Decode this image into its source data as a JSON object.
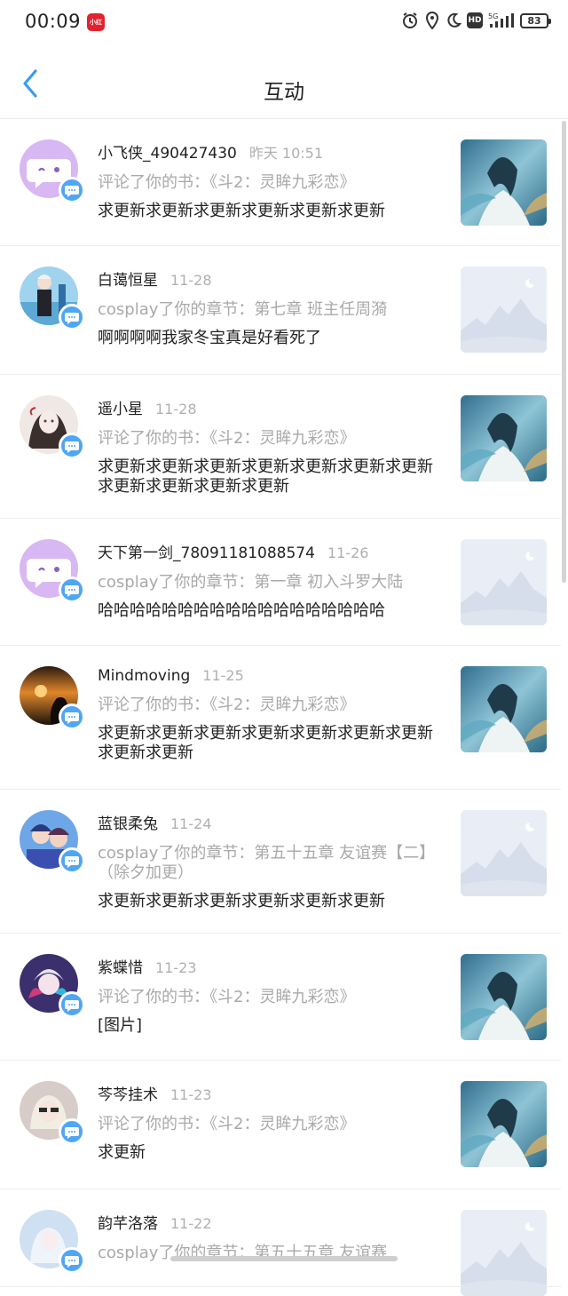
{
  "status": {
    "time": "00:09",
    "app_badge": "小红书",
    "network": "5G",
    "battery": "83",
    "hd": "HD"
  },
  "header": {
    "title": "互动"
  },
  "items": [
    {
      "user": "小飞侠_490427430",
      "time": "昨天 10:51",
      "action": "评论了你的书：《斗2：灵眸九彩恋》",
      "content": "求更新求更新求更新求更新求更新求更新",
      "avatar": "purple-face",
      "thumb": "cover"
    },
    {
      "user": "白蔼恒星",
      "time": "11-28",
      "action": "cosplay了你的章节：第七章 班主任周漪",
      "content": "啊啊啊啊我家冬宝真是好看死了",
      "avatar": "anime-boy",
      "thumb": "placeholder"
    },
    {
      "user": "遥小星",
      "time": "11-28",
      "action": "评论了你的书：《斗2：灵眸九彩恋》",
      "content": "求更新求更新求更新求更新求更新求更新求更新求更新求更新求更新求更新",
      "avatar": "sketch-girl",
      "thumb": "cover"
    },
    {
      "user": "天下第一剑_78091181088574",
      "time": "11-26",
      "action": "cosplay了你的章节：第一章 初入斗罗大陆",
      "content": "哈哈哈哈哈哈哈哈哈哈哈哈哈哈哈哈哈哈",
      "avatar": "purple-face",
      "thumb": "placeholder"
    },
    {
      "user": "Mindmoving",
      "time": "11-25",
      "action": "评论了你的书：《斗2：灵眸九彩恋》",
      "content": "求更新求更新求更新求更新求更新求更新求更新求更新求更新",
      "avatar": "sunset",
      "thumb": "cover"
    },
    {
      "user": "蓝银柔兔",
      "time": "11-24",
      "action": "cosplay了你的章节：第五十五章 友谊赛【二】（除夕加更）",
      "content": "求更新求更新求更新求更新求更新求更新",
      "avatar": "anime-pair",
      "thumb": "placeholder"
    },
    {
      "user": "紫蝶惜",
      "time": "11-23",
      "action": "评论了你的书：《斗2：灵眸九彩恋》",
      "content": "[图片]",
      "avatar": "anime-colorful",
      "thumb": "cover"
    },
    {
      "user": "芩芩挂术",
      "time": "11-23",
      "action": "评论了你的书：《斗2：灵眸九彩恋》",
      "content": "求更新",
      "avatar": "anime-blonde",
      "thumb": "cover"
    },
    {
      "user": "韵芊洛落",
      "time": "11-22",
      "action": "cosplay了你的章节：第五十五章 友谊赛",
      "content": "",
      "avatar": "anime-icy",
      "thumb": "placeholder"
    }
  ],
  "colors": {
    "accent": "#3a9cf0",
    "badge": "#4fa6f5",
    "muted": "#a9a9a9",
    "avatar_purple": "#d7b8f3"
  }
}
